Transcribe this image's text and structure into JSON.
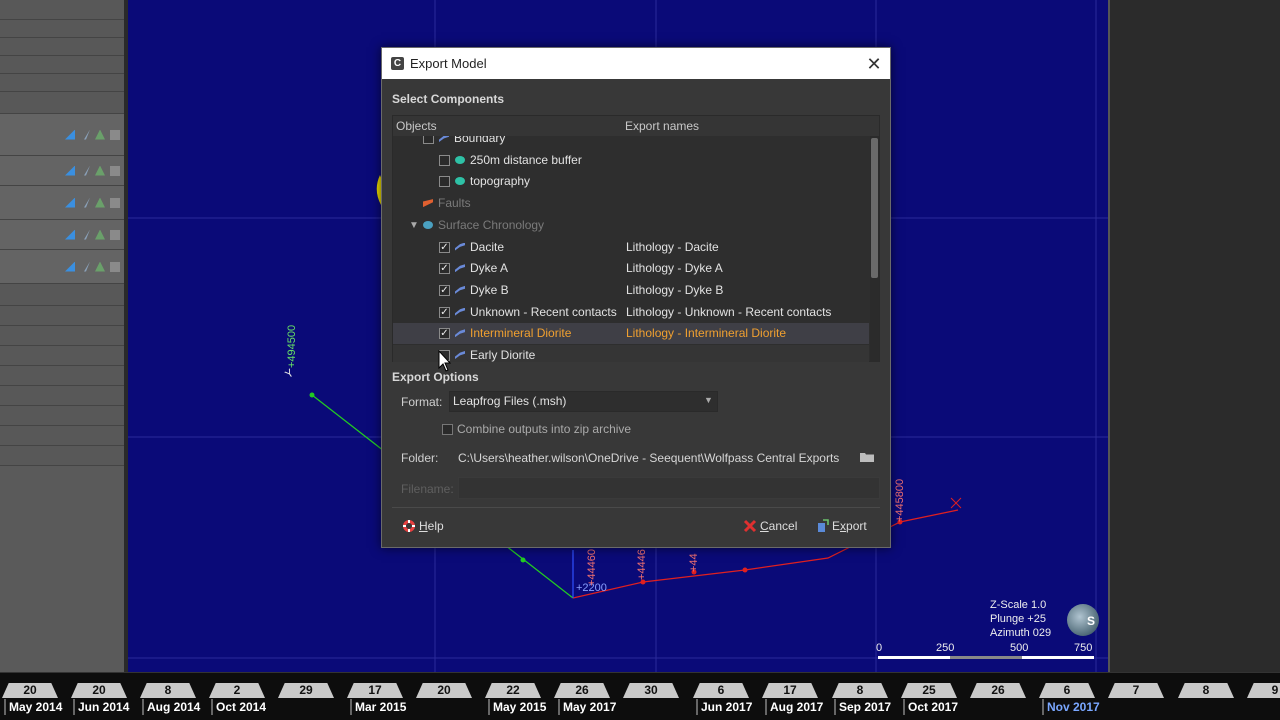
{
  "dialog": {
    "title": "Export Model",
    "select_components": "Select Components",
    "columns": {
      "objects": "Objects",
      "export_names": "Export names"
    },
    "tree": [
      {
        "label": "Boundary",
        "export": "",
        "checked": false,
        "icon": "surface-icon",
        "indent": 2,
        "dim": false
      },
      {
        "label": "250m distance buffer",
        "export": "",
        "checked": false,
        "icon": "buffer-icon",
        "indent": 3,
        "dim": false
      },
      {
        "label": "topography",
        "export": "",
        "checked": false,
        "icon": "buffer-icon",
        "indent": 3,
        "dim": false
      },
      {
        "label": "Faults",
        "export": "",
        "checked": null,
        "icon": "fault-icon",
        "indent": 2,
        "dim": true
      },
      {
        "label": "Surface Chronology",
        "export": "",
        "checked": null,
        "icon": "chronology-icon",
        "indent": 1,
        "dim": true
      },
      {
        "label": "Dacite",
        "export": "Lithology - Dacite",
        "checked": true,
        "icon": "surface-icon",
        "indent": 3,
        "dim": false
      },
      {
        "label": "Dyke A",
        "export": "Lithology - Dyke A",
        "checked": true,
        "icon": "surface-icon",
        "indent": 3,
        "dim": false
      },
      {
        "label": "Dyke B",
        "export": "Lithology - Dyke B",
        "checked": true,
        "icon": "surface-icon",
        "indent": 3,
        "dim": false
      },
      {
        "label": "Unknown - Recent contacts",
        "export": "Lithology - Unknown - Recent contacts",
        "checked": true,
        "icon": "surface-icon",
        "indent": 3,
        "dim": false
      },
      {
        "label": "Intermineral Diorite",
        "export": "Lithology - Intermineral Diorite",
        "checked": true,
        "icon": "surface-icon",
        "indent": 3,
        "dim": false,
        "highlight": true
      },
      {
        "label": "Early Diorite",
        "export": "",
        "checked": false,
        "icon": "surface-icon",
        "indent": 3,
        "dim": false
      }
    ],
    "export_options": "Export Options",
    "format_label": "Format:",
    "format_value": "Leapfrog Files (.msh)",
    "zip_label": "Combine outputs into zip archive",
    "folder_label": "Folder:",
    "folder_value": "C:\\Users\\heather.wilson\\OneDrive - Seequent\\Wolfpass Central Exports",
    "filename_label": "Filename:",
    "help": "Help",
    "cancel": "Cancel",
    "export": "Export"
  },
  "scene": {
    "labels": [
      "Y",
      "+494500",
      "+445800",
      "+2200",
      "+44460",
      "+4446",
      "+44"
    ],
    "zscale": "Z-Scale 1.0",
    "plunge": "Plunge +25",
    "azimuth": "Azimuth 029",
    "compass_letter": "S",
    "scalebar": [
      "0",
      "250",
      "500",
      "750"
    ]
  },
  "timeline": {
    "days": [
      "20",
      "20",
      "8",
      "2",
      "29",
      "17",
      "20",
      "22",
      "26",
      "30",
      "6",
      "17",
      "8",
      "25",
      "26",
      "6",
      "7",
      "8",
      "9"
    ],
    "months": [
      {
        "label": "May 2014",
        "active": false
      },
      {
        "label": "Jun 2014",
        "active": false
      },
      {
        "label": "Aug 2014",
        "active": false
      },
      {
        "label": "Oct 2014",
        "active": false
      },
      {
        "label": "Mar 2015",
        "active": false
      },
      {
        "label": "May 2015",
        "active": false
      },
      {
        "label": "May 2017",
        "active": false
      },
      {
        "label": "Jun 2017",
        "active": false
      },
      {
        "label": "Aug 2017",
        "active": false
      },
      {
        "label": "Sep 2017",
        "active": false
      },
      {
        "label": "Oct 2017",
        "active": false
      },
      {
        "label": "Nov 2017",
        "active": true
      }
    ]
  },
  "colors": {
    "scene_bg": "#0a0a78",
    "highlight": "#f0a030",
    "green_line": "#22cc22",
    "red_line": "#e02020",
    "active_month": "#7aa7ff"
  }
}
